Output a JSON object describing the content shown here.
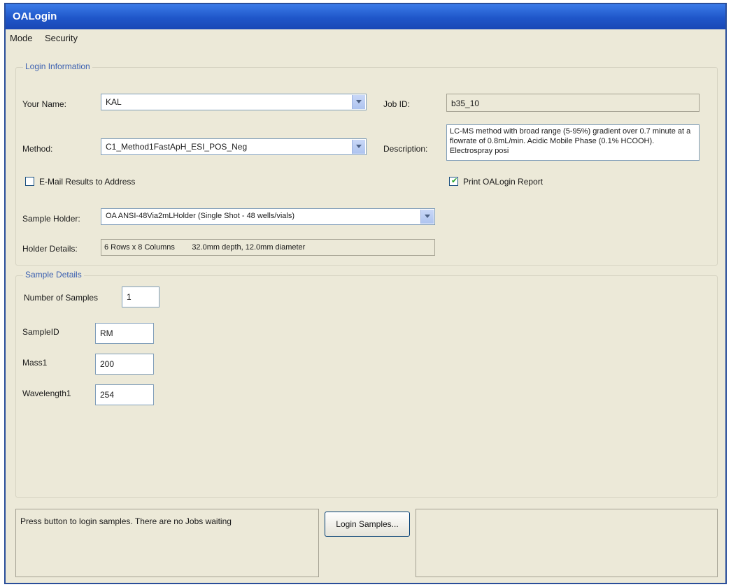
{
  "window": {
    "title": "OALogin"
  },
  "menu": {
    "items": [
      "Mode",
      "Security"
    ]
  },
  "login": {
    "legend": "Login Information",
    "name_label": "Your Name:",
    "name_value": "KAL",
    "jobid_label": "Job ID:",
    "jobid_value": "b35_10",
    "method_label": "Method:",
    "method_value": "C1_Method1FastApH_ESI_POS_Neg",
    "description_label": "Description:",
    "description_text": "LC-MS method with broad range (5-95%) gradient over 0.7 minute at a flowrate of 0.8mL/min. Acidic Mobile Phase (0.1% HCOOH). Electrospray posi",
    "email_label": "E-Mail Results to Address",
    "email_checked": false,
    "print_label": "Print OALogin Report",
    "print_checked": true,
    "holder_label": "Sample Holder:",
    "holder_value": "OA ANSI-48Via2mLHolder  (Single Shot - 48 wells/vials)",
    "holder_details_label": "Holder Details:",
    "holder_details_text": "6 Rows x 8 Columns        32.0mm depth, 12.0mm diameter"
  },
  "sample": {
    "legend": "Sample Details",
    "number_label": "Number of Samples",
    "number_value": "1",
    "sampleid_label": "SampleID",
    "sampleid_value": "RM",
    "mass_label": "Mass1",
    "mass_value": "200",
    "wavelength_label": "Wavelength1",
    "wavelength_value": "254"
  },
  "footer": {
    "status_text": "Press button to login samples. There are no Jobs waiting",
    "login_button": "Login Samples..."
  }
}
